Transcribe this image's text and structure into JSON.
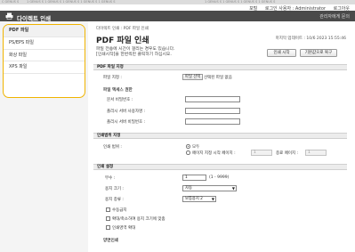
{
  "top_strip": {
    "texts": [
      "C GENUS S",
      "1 GENUS S 1 GENUS S 1 GENUS S 1 GENUS S 1 GENUS S",
      "1 GENUS S 1 GENUS S 1 GENUS S 1 GENUS S"
    ]
  },
  "top_bar": {
    "portal": "포털",
    "login_user": "로그인 사용자 : Administrator",
    "logout": "로그아웃"
  },
  "header": {
    "title": "다이렉트 인쇄",
    "admin_link": "관리자에게 문의"
  },
  "sidebar": {
    "items": [
      {
        "label": "PDF 파일",
        "active": true
      },
      {
        "label": "PS/EPS 파일",
        "active": false
      },
      {
        "label": "화상 파일",
        "active": false
      },
      {
        "label": "XPS 파일",
        "active": false
      }
    ]
  },
  "main": {
    "breadcrumb": "다이렉트 인쇄 : PDF 파일 인쇄",
    "title": "PDF 파일 인쇄",
    "updated": "마지막 업데이트 : 10/6 2023 15:55:46",
    "desc_line1": "파일 전송에 시간이 걸리는 경우도 있습니다.",
    "desc_line2": "[인쇄시작]을 한번씩만 클릭하기 하십시오.",
    "start_button": "인쇄 시작",
    "return_button": "기본값으로 복구"
  },
  "section_file": {
    "header": "PDF 파일 지정",
    "file_label": "파일 지정 :",
    "choose_button": "파일 선택",
    "no_file": "선택된 파일 없음",
    "access_title": "파일 액세스 권한",
    "doc_password": "문서 비밀번호 :",
    "policy_user": "폴리시 서버 사용자명 :",
    "policy_password": "폴리시 서버 비밀번호 :"
  },
  "section_range": {
    "header": "인쇄범위 지정",
    "range_label": "인쇄 범위 :",
    "option_all": "모두",
    "option_pages": "페이지 지정 시작 페이지 :",
    "start_value": "1",
    "end_label": "종료 페이지 :",
    "end_value": "1"
  },
  "section_settings": {
    "header": "인쇄 설정",
    "copies_label": "부수 :",
    "copies_value": "1",
    "copies_range": "(1 - 9999)",
    "paper_size_label": "용지 크기 :",
    "paper_size_value": "자동",
    "paper_type_label": "용지 종류 :",
    "paper_type_value": "보통용지 2",
    "check_collate": "수동급지",
    "check_fit": "확대/축소하여 용지 크기에 맞춤",
    "check_enlarge": "인쇄영역 확대",
    "duplex_title": "양면인쇄"
  }
}
